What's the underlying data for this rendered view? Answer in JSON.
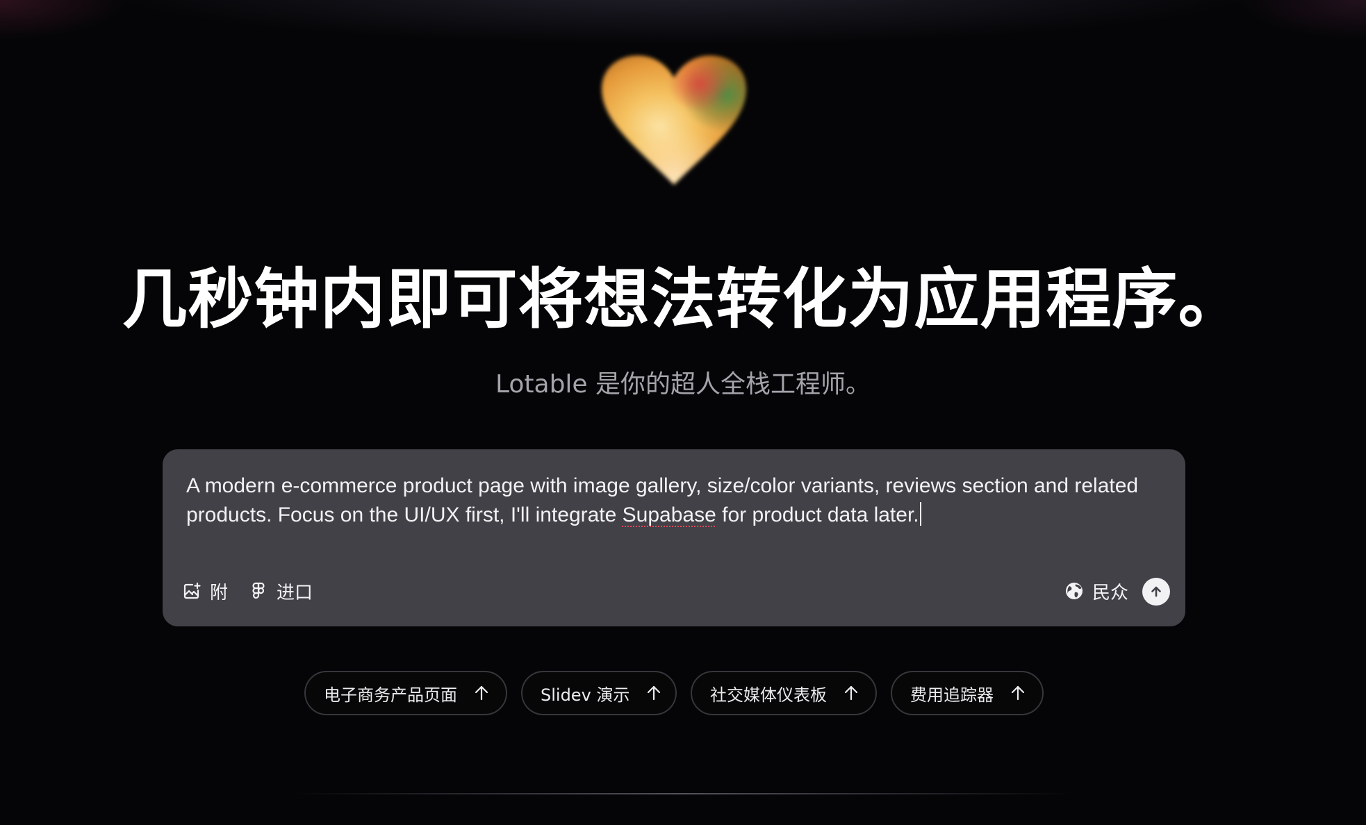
{
  "logo": {
    "icon": "heart-icon",
    "colors": [
      "#f4a63c",
      "#f7d07a",
      "#e0624a",
      "#3c8a3e"
    ]
  },
  "hero": {
    "headline": "几秒钟内即可将想法转化为应用程序。",
    "subtitle": "Lotable 是你的超人全栈工程师。"
  },
  "prompt": {
    "text_before": "A modern e-commerce product page with image gallery, size/color variants, reviews section and related products. Focus on the UI/UX first, I'll integrate ",
    "text_misspelled": "Supabase",
    "text_after": " for product data later.",
    "attach_label": "附",
    "import_label": "进口",
    "visibility_label": "民众",
    "icons": {
      "attach": "image-plus-icon",
      "import": "figma-icon",
      "visibility": "globe-icon",
      "send": "arrow-up-icon"
    }
  },
  "suggestions": [
    {
      "label": "电子商务产品页面",
      "icon": "arrow-up-icon"
    },
    {
      "label": "Slidev 演示",
      "icon": "arrow-up-icon"
    },
    {
      "label": "社交媒体仪表板",
      "icon": "arrow-up-icon"
    },
    {
      "label": "费用追踪器",
      "icon": "arrow-up-icon"
    }
  ],
  "colors": {
    "background": "#050507",
    "card": "#414147",
    "subtitle": "#a4a4ab",
    "chip_border": "#36363c",
    "spellcheck": "#e0485a"
  }
}
